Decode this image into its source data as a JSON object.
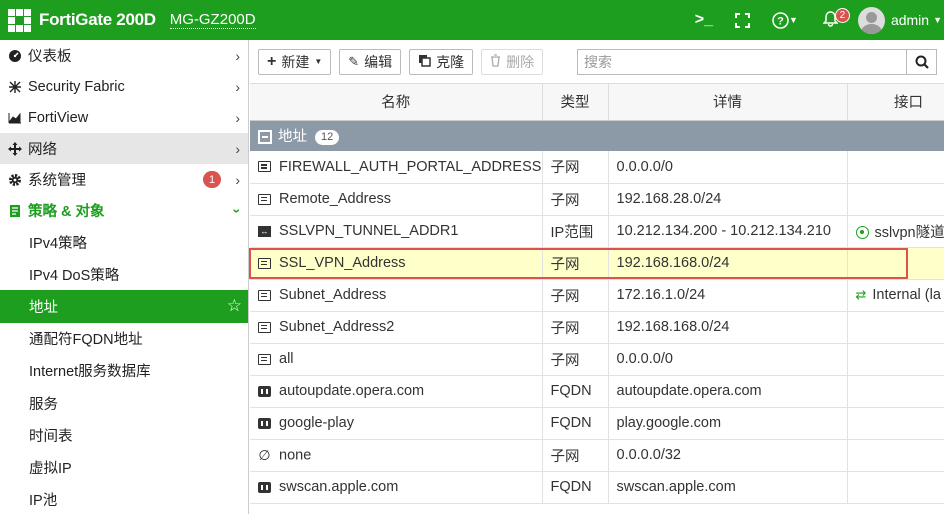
{
  "header": {
    "brand": "FortiGate 200D",
    "hostname": "MG-GZ200D",
    "notification_count": "2",
    "user": "admin",
    "icons": [
      "terminal-icon",
      "fullscreen-icon",
      "help-icon",
      "bell-icon",
      "avatar"
    ]
  },
  "sidebar": {
    "items": [
      {
        "label": "仪表板",
        "icon": "dashboard-icon"
      },
      {
        "label": "Security Fabric",
        "icon": "fabric-icon"
      },
      {
        "label": "FortiView",
        "icon": "chart-icon"
      },
      {
        "label": "网络",
        "icon": "network-icon"
      },
      {
        "label": "系统管理",
        "icon": "gear-icon",
        "badge": "1"
      },
      {
        "label": "策略 & 对象",
        "icon": "policy-icon"
      }
    ],
    "subitems": [
      "IPv4策略",
      "IPv4 DoS策略",
      "地址",
      "通配符FQDN地址",
      "Internet服务数据库",
      "服务",
      "时间表",
      "虚拟IP",
      "IP池"
    ]
  },
  "toolbar": {
    "new_label": "新建",
    "edit_label": "编辑",
    "clone_label": "克隆",
    "delete_label": "删除",
    "search_placeholder": "搜索"
  },
  "table": {
    "columns": [
      "名称",
      "类型",
      "详情",
      "接口"
    ],
    "group": {
      "label": "地址",
      "count": "12"
    },
    "rows": [
      {
        "name": "FIREWALL_AUTH_PORTAL_ADDRESS",
        "type": "子网",
        "details": "0.0.0.0/0",
        "interface": ""
      },
      {
        "name": "Remote_Address",
        "type": "子网",
        "details": "192.168.28.0/24",
        "interface": ""
      },
      {
        "name": "SSLVPN_TUNNEL_ADDR1",
        "type": "IP范围",
        "details": "10.212.134.200 - 10.212.134.210",
        "interface": "sslvpn隧道"
      },
      {
        "name": "SSL_VPN_Address",
        "type": "子网",
        "details": "192.168.168.0/24",
        "interface": ""
      },
      {
        "name": "Subnet_Address",
        "type": "子网",
        "details": "172.16.1.0/24",
        "interface": "Internal (la"
      },
      {
        "name": "Subnet_Address2",
        "type": "子网",
        "details": "192.168.168.0/24",
        "interface": ""
      },
      {
        "name": "all",
        "type": "子网",
        "details": "0.0.0.0/0",
        "interface": ""
      },
      {
        "name": "autoupdate.opera.com",
        "type": "FQDN",
        "details": "autoupdate.opera.com",
        "interface": ""
      },
      {
        "name": "google-play",
        "type": "FQDN",
        "details": "play.google.com",
        "interface": ""
      },
      {
        "name": "none",
        "type": "子网",
        "details": "0.0.0.0/32",
        "interface": ""
      },
      {
        "name": "swscan.apple.com",
        "type": "FQDN",
        "details": "swscan.apple.com",
        "interface": ""
      }
    ]
  },
  "colors": {
    "accent": "#1e9e1e",
    "group_bar": "#8c99a6",
    "selected_row": "#ffffc9",
    "highlight_box": "#d9534f"
  }
}
